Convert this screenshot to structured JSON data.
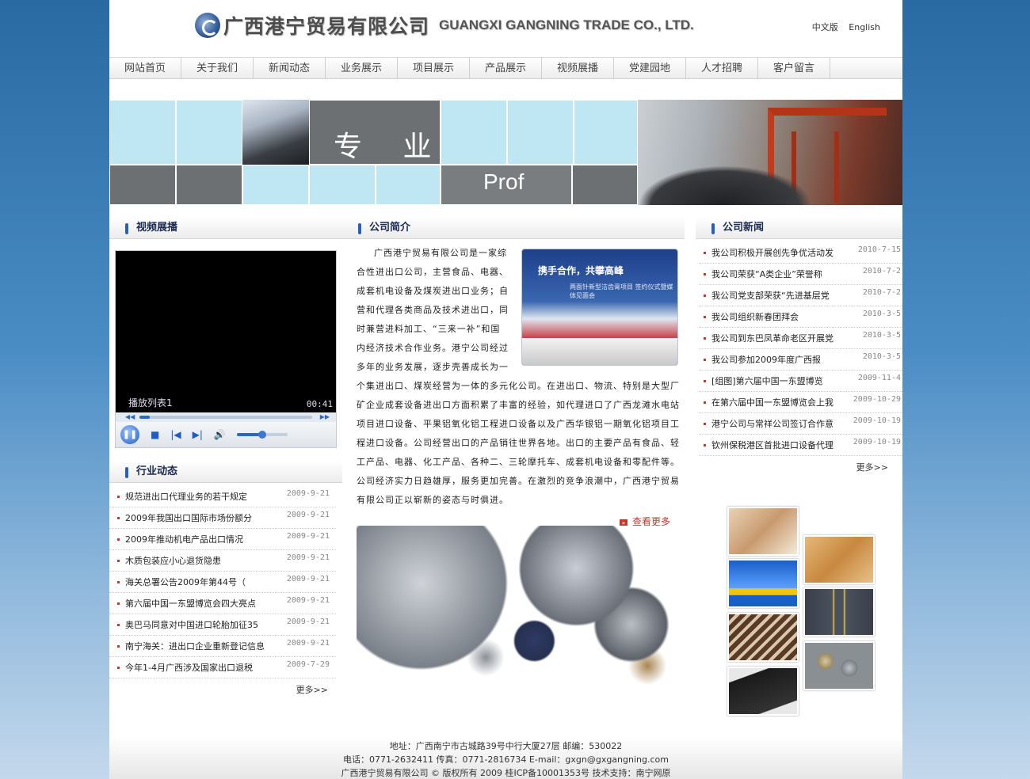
{
  "header": {
    "company_cn": "广西港宁贸易有限公司",
    "company_en": "GUANGXI GANGNING TRADE CO., LTD.",
    "lang_cn": "中文版",
    "lang_en": "English"
  },
  "nav": [
    "网站首页",
    "关于我们",
    "新闻动态",
    "业务展示",
    "项目展示",
    "产品展示",
    "视频展播",
    "党建园地",
    "人才招聘",
    "客户留言"
  ],
  "banner": {
    "text_cn": "专 业",
    "text_en": "Prof"
  },
  "video": {
    "title": "视频展播",
    "playlist_label": "播放列表1",
    "time": "00:41",
    "progress": 0.06,
    "volume": 0.5
  },
  "industry": {
    "title": "行业动态",
    "items": [
      {
        "text": "规范进出口代理业务的若干规定",
        "date": "2009-9-21"
      },
      {
        "text": "2009年我国出口国际市场份额分",
        "date": "2009-9-21"
      },
      {
        "text": "2009年推动机电产品出口情况",
        "date": "2009-9-21"
      },
      {
        "text": "木质包装应小心退货隐患",
        "date": "2009-9-21"
      },
      {
        "text": "海关总署公告2009年第44号（",
        "date": "2009-9-21"
      },
      {
        "text": "第六届中国一东盟博览会四大亮点",
        "date": "2009-9-21"
      },
      {
        "text": "奥巴马同意对中国进口轮胎加征35",
        "date": "2009-9-21"
      },
      {
        "text": "南宁海关：进出口企业重新登记信息",
        "date": "2009-9-21"
      },
      {
        "text": "今年1-4月广西涉及国家出口退税",
        "date": "2009-7-29"
      }
    ],
    "more": "更多>>"
  },
  "intro": {
    "title": "公司简介",
    "photo_title": "携手合作，共攀高峰",
    "photo_sub": "两面针新型洁齿膏项目 签约仪式暨媒体见面会",
    "lines_wrap": [
      "广西港宁贸易有限公司是一家综",
      "合性进出口公司，主营食品、电器、",
      "成套机电设备及煤炭进出口业务；自",
      "营和代理各类商品及技术进出口，同",
      "时兼营进料加工、“三来一补”和国",
      "内经济技术合作业务。港宁公司经过",
      "多年的业务发展，逐步壳善成长为一"
    ],
    "lines_rest": [
      "个集进出口、煤炭经营为一体的多元化公司。在进出口、物流、特别是大型厂",
      "矿企业成套设备进出口方面积累了丰富的经验，如代理进口了广西龙滩水电站",
      "项目进口设备、平果铝氧化铝工程进口设备以及广西华银铝一期氧化铝项目工",
      "程进口设备。公司经营出口的产品销往世界各地。出口的主要产品有食品、轻",
      "工产品、电器、化工产品、各种二、三轮摩托车、成套机电设备和零配件等。",
      "公司经济实力日趋雄厚，服务更加完善。在激烈的竞争浪潮中，广西港宁贸易",
      "有限公司正以崭新的姿态与时俱进。"
    ],
    "view_more": "查看更多"
  },
  "company_news": {
    "title": "公司新闻",
    "items": [
      {
        "text": "我公司积极开展创先争优活动发",
        "date": "2010-7-15"
      },
      {
        "text": "我公司荣获“A类企业”荣誉称",
        "date": "2010-7-2"
      },
      {
        "text": "我公司党支部荣获“先进基层党",
        "date": "2010-7-2"
      },
      {
        "text": "我公司组织新春团拜会",
        "date": "2010-3-5"
      },
      {
        "text": "我公司到东巴凤革命老区开展党",
        "date": "2010-3-5"
      },
      {
        "text": "我公司参加2009年度广西报",
        "date": "2010-3-5"
      },
      {
        "text": "[组图]第六届中国一东盟博览",
        "date": "2009-11-4"
      },
      {
        "text": "在第六届中国一东盟博览会上我",
        "date": "2009-10-29"
      },
      {
        "text": "港宁公司与常祥公司签订合作意",
        "date": "2009-10-19"
      },
      {
        "text": "钦州保税港区首批进口设备代理",
        "date": "2009-10-19"
      }
    ],
    "more": "更多>>"
  },
  "footer": {
    "line1": "地址：广西南宁市古城路39号中行大厦27层 邮编：530022",
    "line2": "电话：0771-2632411 传真：0771-2816734 E-mail：gxgn@gxgangning.com",
    "line3": "广西港宁贸易有限公司 © 版权所有 2009  桂ICP备10001353号 技术支持：南宁网原"
  }
}
